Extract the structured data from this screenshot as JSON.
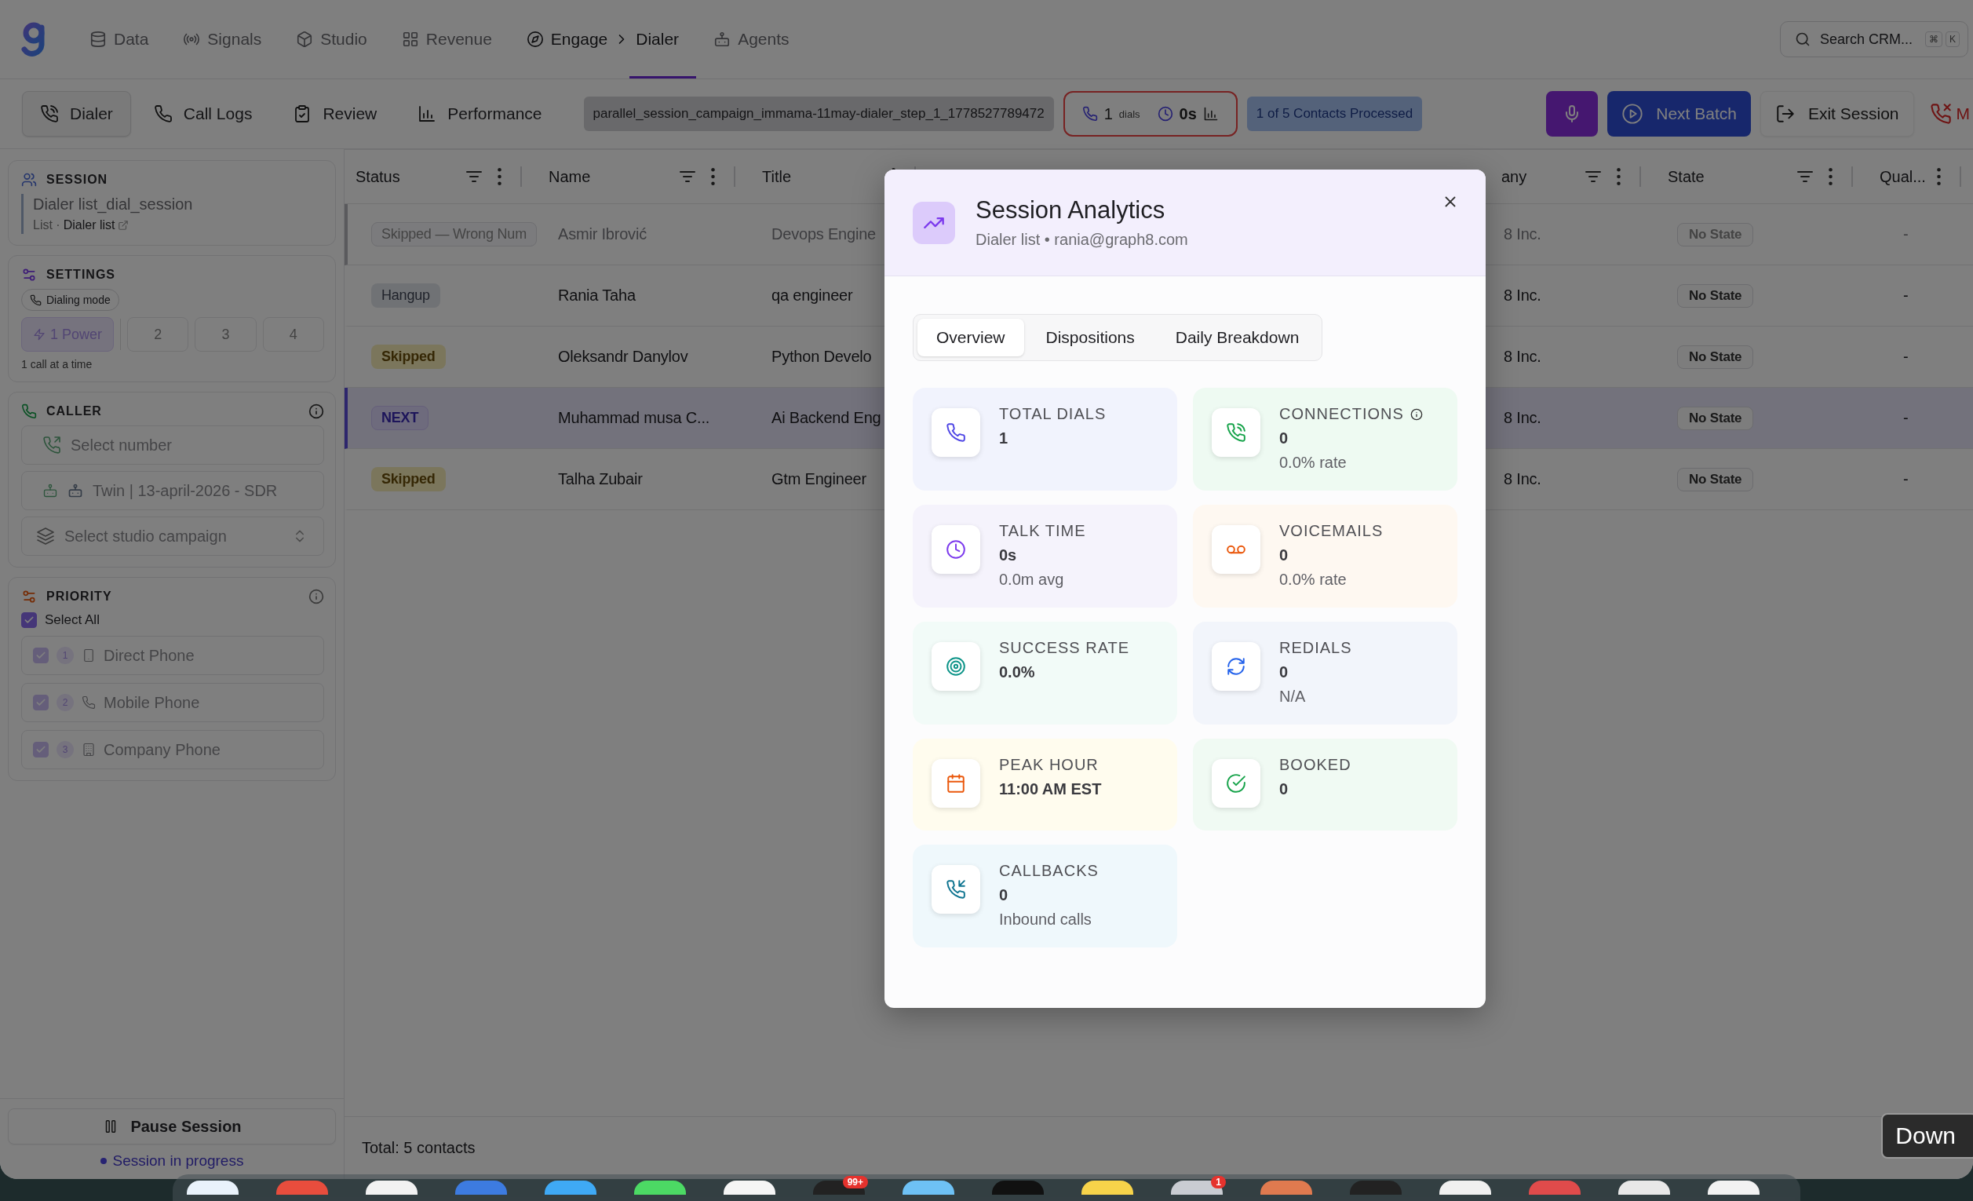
{
  "topbar": {
    "nav": [
      {
        "label": "Data",
        "kind": "link",
        "selected": false
      },
      {
        "label": "Signals",
        "kind": "link",
        "selected": false
      },
      {
        "label": "Studio",
        "kind": "link",
        "selected": false
      },
      {
        "label": "Revenue",
        "kind": "link",
        "selected": false
      },
      {
        "label": "Engage",
        "kind": "crumb",
        "selected": false
      },
      {
        "label": "Dialer",
        "kind": "page",
        "selected": true
      },
      {
        "label": "Agents",
        "kind": "link",
        "selected": false
      }
    ],
    "search": {
      "placeholder": "Search CRM...",
      "keys": [
        "⌘",
        "K"
      ]
    }
  },
  "toolbar": {
    "tabs": [
      {
        "label": "Dialer",
        "selected": true
      },
      {
        "label": "Call Logs",
        "selected": false
      },
      {
        "label": "Review",
        "selected": false
      },
      {
        "label": "Performance",
        "selected": false
      }
    ],
    "session_id": "parallel_session_campaign_immama-11may-dialer_step_1_1778527789472",
    "dials": "1",
    "dials_label": "dials",
    "duration": "0s",
    "progress": "1 of 5 Contacts Processed",
    "next_batch": "Next Batch",
    "exit": "Exit Session",
    "end_call": "M"
  },
  "sidebar": {
    "session": {
      "title": "SESSION",
      "name": "Dialer list_dial_session",
      "list_label": "List ·",
      "list_link": "Dialer list"
    },
    "settings": {
      "title": "SETTINGS",
      "mode_chip": "Dialing mode",
      "modes": [
        {
          "label": "1 Power",
          "selected": true
        },
        {
          "label": "2",
          "selected": false
        },
        {
          "label": "3",
          "selected": false
        },
        {
          "label": "4",
          "selected": false
        }
      ],
      "note": "1 call at a time"
    },
    "caller": {
      "title": "CALLER",
      "number_placeholder": "Select number",
      "agent": "Twin | 13-april-2026 - SDR",
      "campaign_placeholder": "Select studio campaign"
    },
    "priority": {
      "title": "PRIORITY",
      "select_all": {
        "label": "Select All",
        "checked": true
      },
      "items": [
        {
          "index": "1",
          "label": "Direct Phone",
          "checked": true
        },
        {
          "index": "2",
          "label": "Mobile Phone",
          "checked": true
        },
        {
          "index": "3",
          "label": "Company Phone",
          "checked": true
        }
      ]
    },
    "pause": "Pause Session",
    "status": "Session in progress"
  },
  "table": {
    "columns": [
      {
        "label": "Status",
        "filter": true
      },
      {
        "label": "Name",
        "filter": true
      },
      {
        "label": "Title",
        "filter": false
      },
      {
        "label": "any",
        "filter": true
      },
      {
        "label": "State",
        "filter": true
      },
      {
        "label": "Qual...",
        "filter": false
      }
    ],
    "rows": [
      {
        "status": {
          "label": "Skipped — Wrong Num",
          "kind": "wrong"
        },
        "name": "Asmir Ibrović",
        "title": "Devops Engine",
        "company": "8 Inc.",
        "state": "No State",
        "qual": "-",
        "faded": true,
        "selected": false
      },
      {
        "status": {
          "label": "Hangup",
          "kind": "hangup"
        },
        "name": "Rania Taha",
        "title": "qa engineer",
        "company": "8 Inc.",
        "state": "No State",
        "qual": "-",
        "faded": false,
        "selected": false
      },
      {
        "status": {
          "label": "Skipped",
          "kind": "skipped"
        },
        "name": "Oleksandr Danylov",
        "title": "Python Develo",
        "company": "8 Inc.",
        "state": "No State",
        "qual": "-",
        "faded": false,
        "selected": false
      },
      {
        "status": {
          "label": "NEXT",
          "kind": "next"
        },
        "name": "Muhammad musa C...",
        "title": "Ai Backend Eng",
        "company": "8 Inc.",
        "state": "No State",
        "qual": "-",
        "faded": false,
        "selected": true
      },
      {
        "status": {
          "label": "Skipped",
          "kind": "skipped"
        },
        "name": "Talha Zubair",
        "title": "Gtm Engineer",
        "company": "8 Inc.",
        "state": "No State",
        "qual": "-",
        "faded": false,
        "selected": false
      }
    ],
    "total": "Total: 5 contacts"
  },
  "modal": {
    "title": "Session Analytics",
    "subtitle": "Dialer list • rania@graph8.com",
    "tabs": [
      {
        "label": "Overview",
        "selected": true
      },
      {
        "label": "Dispositions",
        "selected": false
      },
      {
        "label": "Daily Breakdown",
        "selected": false
      }
    ],
    "cards": [
      {
        "kind": "dials",
        "label": "TOTAL DIALS",
        "value": "1",
        "info": false
      },
      {
        "kind": "connections",
        "label": "CONNECTIONS",
        "value": "0",
        "note": "0.0% rate",
        "info": true
      },
      {
        "kind": "talk",
        "label": "TALK TIME",
        "value": "0s",
        "note": "0.0m avg",
        "info": false
      },
      {
        "kind": "voicemails",
        "label": "VOICEMAILS",
        "value": "0",
        "note": "0.0% rate",
        "info": false
      },
      {
        "kind": "success",
        "label": "SUCCESS RATE",
        "value": "0.0%",
        "info": false
      },
      {
        "kind": "redials",
        "label": "REDIALS",
        "value": "0",
        "note": "N/A",
        "info": false
      },
      {
        "kind": "peak",
        "label": "PEAK HOUR",
        "value": "11:00 AM EST",
        "info": false
      },
      {
        "kind": "booked",
        "label": "BOOKED",
        "value": "0",
        "info": false
      },
      {
        "kind": "callbacks",
        "label": "CALLBACKS",
        "value": "0",
        "note": "Inbound calls",
        "info": false
      }
    ]
  },
  "tooltip": "Down",
  "dock_badges": [
    "99+",
    "1"
  ]
}
